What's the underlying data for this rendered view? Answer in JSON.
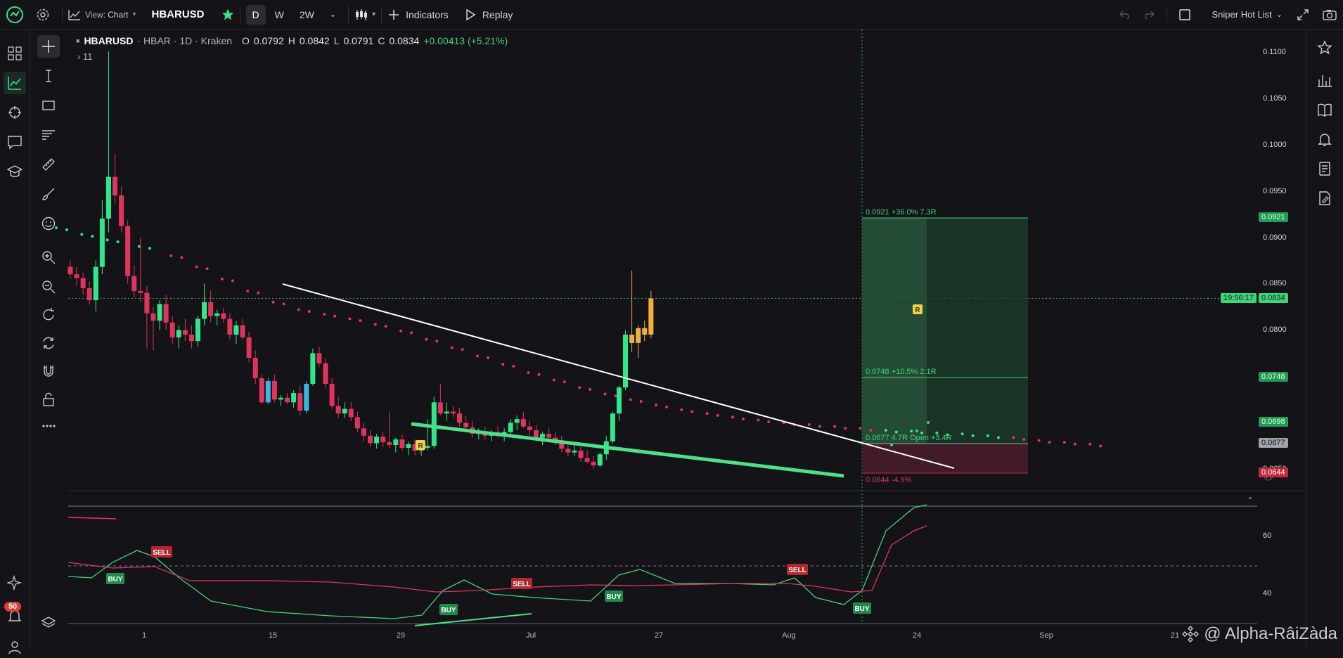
{
  "toolbar": {
    "view_label": "View:",
    "view_value": "Chart",
    "symbol": "HBARUSD",
    "timeframes": [
      "D",
      "W",
      "2W"
    ],
    "active_timeframe": "D",
    "indicators_label": "Indicators",
    "replay_label": "Replay",
    "watchlist": "Sniper Hot List"
  },
  "legend": {
    "symbol": "HBARUSD",
    "details": "· HBAR · 1D · Kraken",
    "open_label": "O",
    "open": "0.0792",
    "high_label": "H",
    "high": "0.0842",
    "low_label": "L",
    "low": "0.0791",
    "close_label": "C",
    "close": "0.0834",
    "change": "+0.00413 (+5.21%)",
    "collapsed_count": "11"
  },
  "price_axis": {
    "ticks": [
      "0.1100",
      "0.1050",
      "0.1000",
      "0.0950",
      "0.0900",
      "0.0850",
      "0.0800",
      "0.0650"
    ],
    "countdown": "19:56:17",
    "current_price": "0.0834",
    "markers": [
      {
        "value": "0.0921",
        "color": "#1f9c56",
        "text_color": "#e8ffe8"
      },
      {
        "value": "0.0748",
        "color": "#1f9c56",
        "text_color": "#e8ffe8"
      },
      {
        "value": "0.0698",
        "color": "#1f9c56",
        "text_color": "#e8ffe8"
      },
      {
        "value": "0.0677",
        "color": "#9ea2ad",
        "text_color": "#111"
      },
      {
        "value": "0.0644",
        "color": "#c8283b",
        "text_color": "#ffffff"
      }
    ]
  },
  "position_tool": {
    "target_label": "0.0921 +36.0% 7.3R",
    "mid_label": "0.0748 +10.5% 2.1R",
    "entry_label": "0.0677 4.7R Open +3.4R",
    "stop_label": "0.0644 -4.9%"
  },
  "time_axis": {
    "ticks": [
      "1",
      "15",
      "29",
      "Jul",
      "27",
      "Aug",
      "24",
      "Sep",
      "21"
    ]
  },
  "oscillator": {
    "ticks": [
      "60",
      "40"
    ],
    "signals": [
      {
        "label": "BUY",
        "type": "buy"
      },
      {
        "label": "SELL",
        "type": "sell"
      },
      {
        "label": "BUY",
        "type": "buy"
      },
      {
        "label": "SELL",
        "type": "sell"
      },
      {
        "label": "BUY",
        "type": "buy"
      },
      {
        "label": "SELL",
        "type": "sell"
      },
      {
        "label": "BUY",
        "type": "buy"
      }
    ]
  },
  "chart_markers": [
    "R",
    "R"
  ],
  "alerts_badge": "50",
  "watermark": "@ Alpha-RâiZàda",
  "colors": {
    "background": "#131318",
    "up": "#2ee88a",
    "down": "#e0345e",
    "trend_support": "#4fdf8a",
    "trend_resistance": "#ffffff",
    "accent": "#2ee88a"
  },
  "chart_data": {
    "type": "candlestick",
    "symbol": "HBARUSD",
    "exchange": "Kraken",
    "interval": "1D",
    "ylim": [
      0.0625,
      0.111
    ],
    "candles": [
      [
        0.0868,
        0.0875,
        0.0855,
        0.086
      ],
      [
        0.086,
        0.0868,
        0.0848,
        0.0856
      ],
      [
        0.0856,
        0.0862,
        0.0838,
        0.0845
      ],
      [
        0.0845,
        0.0852,
        0.0828,
        0.0832
      ],
      [
        0.0832,
        0.0875,
        0.082,
        0.0868
      ],
      [
        0.0868,
        0.094,
        0.086,
        0.092
      ],
      [
        0.092,
        0.11,
        0.0905,
        0.0965
      ],
      [
        0.0965,
        0.099,
        0.0935,
        0.0945
      ],
      [
        0.0945,
        0.0955,
        0.0905,
        0.0912
      ],
      [
        0.0912,
        0.0918,
        0.085,
        0.0858
      ],
      [
        0.0858,
        0.087,
        0.0835,
        0.0842
      ],
      [
        0.0842,
        0.09,
        0.083,
        0.084
      ],
      [
        0.084,
        0.0848,
        0.078,
        0.0818
      ],
      [
        0.0818,
        0.0825,
        0.0778,
        0.081
      ],
      [
        0.081,
        0.0832,
        0.08,
        0.0828
      ],
      [
        0.0828,
        0.0838,
        0.08,
        0.0808
      ],
      [
        0.0808,
        0.0815,
        0.0785,
        0.0792
      ],
      [
        0.0792,
        0.0805,
        0.078,
        0.08
      ],
      [
        0.08,
        0.0812,
        0.0788,
        0.0795
      ],
      [
        0.0795,
        0.0805,
        0.078,
        0.0788
      ],
      [
        0.0788,
        0.0815,
        0.0782,
        0.0812
      ],
      [
        0.0812,
        0.085,
        0.0805,
        0.083
      ],
      [
        0.083,
        0.0842,
        0.0808,
        0.0815
      ],
      [
        0.0815,
        0.0822,
        0.0805,
        0.0818
      ],
      [
        0.0818,
        0.0824,
        0.0808,
        0.0812
      ],
      [
        0.0812,
        0.0818,
        0.079,
        0.0795
      ],
      [
        0.0795,
        0.081,
        0.0785,
        0.0805
      ],
      [
        0.0805,
        0.0812,
        0.079,
        0.0792
      ],
      [
        0.0792,
        0.0798,
        0.0765,
        0.077
      ],
      [
        0.077,
        0.0778,
        0.0742,
        0.0748
      ],
      [
        0.0748,
        0.0752,
        0.072,
        0.0722
      ],
      [
        0.0722,
        0.0748,
        0.072,
        0.0745
      ],
      [
        0.0745,
        0.0752,
        0.0722,
        0.0725
      ],
      [
        0.0725,
        0.073,
        0.0718,
        0.0727
      ],
      [
        0.0727,
        0.0732,
        0.072,
        0.0722
      ],
      [
        0.0722,
        0.0735,
        0.0716,
        0.0732
      ],
      [
        0.0732,
        0.074,
        0.0708,
        0.0713
      ],
      [
        0.0713,
        0.0745,
        0.071,
        0.0742
      ],
      [
        0.0742,
        0.078,
        0.074,
        0.0775
      ],
      [
        0.0775,
        0.0782,
        0.076,
        0.0764
      ],
      [
        0.0764,
        0.077,
        0.0738,
        0.0742
      ],
      [
        0.0742,
        0.0748,
        0.0715,
        0.0718
      ],
      [
        0.0718,
        0.0728,
        0.0705,
        0.071
      ],
      [
        0.071,
        0.0722,
        0.0705,
        0.0715
      ],
      [
        0.0715,
        0.0722,
        0.0702,
        0.0706
      ],
      [
        0.0706,
        0.0712,
        0.069,
        0.0694
      ],
      [
        0.0694,
        0.07,
        0.068,
        0.0686
      ],
      [
        0.0686,
        0.0692,
        0.0674,
        0.0678
      ],
      [
        0.0678,
        0.0688,
        0.0672,
        0.0685
      ],
      [
        0.0685,
        0.069,
        0.0674,
        0.0679
      ],
      [
        0.0679,
        0.0712,
        0.0672,
        0.0676
      ],
      [
        0.0676,
        0.0684,
        0.0668,
        0.0682
      ],
      [
        0.0682,
        0.0688,
        0.067,
        0.0673
      ],
      [
        0.0673,
        0.068,
        0.0665,
        0.0677
      ],
      [
        0.0677,
        0.0682,
        0.0665,
        0.067
      ],
      [
        0.067,
        0.0676,
        0.0664,
        0.0673
      ],
      [
        0.0673,
        0.0704,
        0.067,
        0.0675
      ],
      [
        0.0675,
        0.0728,
        0.0672,
        0.0722
      ],
      [
        0.0722,
        0.0742,
        0.0708,
        0.071
      ],
      [
        0.071,
        0.0722,
        0.0702,
        0.0712
      ],
      [
        0.0712,
        0.0718,
        0.0706,
        0.071
      ],
      [
        0.071,
        0.0716,
        0.0696,
        0.07
      ],
      [
        0.07,
        0.0708,
        0.069,
        0.0695
      ],
      [
        0.0695,
        0.0702,
        0.0684,
        0.0688
      ],
      [
        0.0688,
        0.0694,
        0.0682,
        0.069
      ],
      [
        0.069,
        0.0696,
        0.0682,
        0.0686
      ],
      [
        0.0686,
        0.0692,
        0.068,
        0.069
      ],
      [
        0.069,
        0.0696,
        0.0684,
        0.0688
      ],
      [
        0.0688,
        0.0694,
        0.068,
        0.069
      ],
      [
        0.069,
        0.0704,
        0.0686,
        0.07
      ],
      [
        0.07,
        0.0708,
        0.0692,
        0.0704
      ],
      [
        0.0704,
        0.0712,
        0.0694,
        0.0696
      ],
      [
        0.0696,
        0.0702,
        0.0686,
        0.0692
      ],
      [
        0.0692,
        0.0698,
        0.068,
        0.0684
      ],
      [
        0.0684,
        0.069,
        0.0676,
        0.0688
      ],
      [
        0.0688,
        0.0694,
        0.068,
        0.0684
      ],
      [
        0.0684,
        0.069,
        0.0676,
        0.068
      ],
      [
        0.068,
        0.0686,
        0.0668,
        0.0672
      ],
      [
        0.0672,
        0.0678,
        0.0664,
        0.0668
      ],
      [
        0.0668,
        0.0676,
        0.0664,
        0.067
      ],
      [
        0.067,
        0.0674,
        0.0658,
        0.0662
      ],
      [
        0.0662,
        0.067,
        0.0656,
        0.0658
      ],
      [
        0.0658,
        0.0664,
        0.065,
        0.0654
      ],
      [
        0.0654,
        0.0668,
        0.0652,
        0.0666
      ],
      [
        0.0666,
        0.0686,
        0.066,
        0.068
      ],
      [
        0.068,
        0.0712,
        0.0678,
        0.071
      ],
      [
        0.071,
        0.074,
        0.0702,
        0.0738
      ],
      [
        0.0738,
        0.08,
        0.0735,
        0.0795
      ],
      [
        0.0795,
        0.0864,
        0.0776,
        0.0786
      ],
      [
        0.0786,
        0.0805,
        0.077,
        0.0802
      ],
      [
        0.0802,
        0.081,
        0.0788,
        0.0795
      ],
      [
        0.0795,
        0.0842,
        0.0791,
        0.0834
      ]
    ],
    "sar_dots": [
      [
        0,
        0.091
      ],
      [
        4,
        0.0903
      ],
      [
        8,
        0.0897
      ],
      [
        13,
        0.089
      ],
      [
        18,
        0.088
      ],
      [
        22,
        0.0868
      ],
      [
        26,
        0.0855
      ],
      [
        30,
        0.0842
      ],
      [
        34,
        0.083
      ],
      [
        38,
        0.0822
      ],
      [
        42,
        0.0817
      ],
      [
        46,
        0.0812
      ],
      [
        50,
        0.0806
      ],
      [
        54,
        0.0799
      ],
      [
        58,
        0.079
      ],
      [
        62,
        0.0781
      ],
      [
        66,
        0.0772
      ],
      [
        70,
        0.0763
      ],
      [
        74,
        0.0754
      ],
      [
        78,
        0.0746
      ],
      [
        82,
        0.0738
      ],
      [
        86,
        0.0731
      ],
      [
        90,
        0.0725
      ],
      [
        94,
        0.0719
      ],
      [
        98,
        0.0714
      ],
      [
        102,
        0.071
      ],
      [
        106,
        0.0706
      ],
      [
        110,
        0.0703
      ],
      [
        114,
        0.07
      ],
      [
        118,
        0.0698
      ],
      [
        122,
        0.0696
      ],
      [
        126,
        0.0694
      ],
      [
        130,
        0.0692
      ],
      [
        134,
        0.0691
      ],
      [
        138,
        0.0689
      ],
      [
        142,
        0.0688
      ],
      [
        146,
        0.0686
      ],
      [
        150,
        0.0684
      ],
      [
        154,
        0.0681
      ],
      [
        158,
        0.0679
      ],
      [
        162,
        0.0677
      ]
    ],
    "trendlines": [
      {
        "from": [
          0.0847,
          15.5
        ],
        "to": [
          0.0657,
          180
        ],
        "color": "#ffffff"
      },
      {
        "from": [
          0.0702,
          29
        ],
        "to": [
          0.0637,
          168
        ],
        "color": "#4fdf8a"
      }
    ],
    "position": {
      "target": 0.0921,
      "mid": 0.0748,
      "entry": 0.0677,
      "stop": 0.0644
    }
  }
}
